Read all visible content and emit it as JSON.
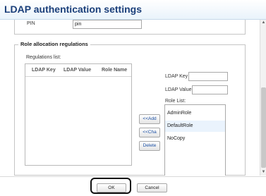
{
  "dialog": {
    "title": "LDAP authentication settings"
  },
  "pin": {
    "label": "PIN",
    "value": "pin"
  },
  "role_allocation": {
    "legend": "Role allocation regulations",
    "regulations_label": "Regulations list:",
    "columns": [
      "LDAP Key",
      "LDAP Value",
      "Role Name"
    ],
    "buttons": {
      "add": "<<Add",
      "change": "<<Cha",
      "delete": "Delete"
    },
    "ldap_key_label": "LDAP Key",
    "ldap_key_value": "",
    "ldap_value_label": "LDAP Value",
    "ldap_value_value": "",
    "role_list_label": "Role List:",
    "roles": [
      {
        "name": "AdminRole"
      },
      {
        "name": "DefaultRole"
      },
      {
        "name": "NoCopy"
      }
    ],
    "selected_role": "DefaultRole"
  },
  "footer": {
    "ok_label": "OK",
    "cancel_label": "Cancel"
  },
  "colors": {
    "title_text": "#1b3f7a",
    "button_text": "#1b4fa3",
    "highlight": "#111111"
  }
}
